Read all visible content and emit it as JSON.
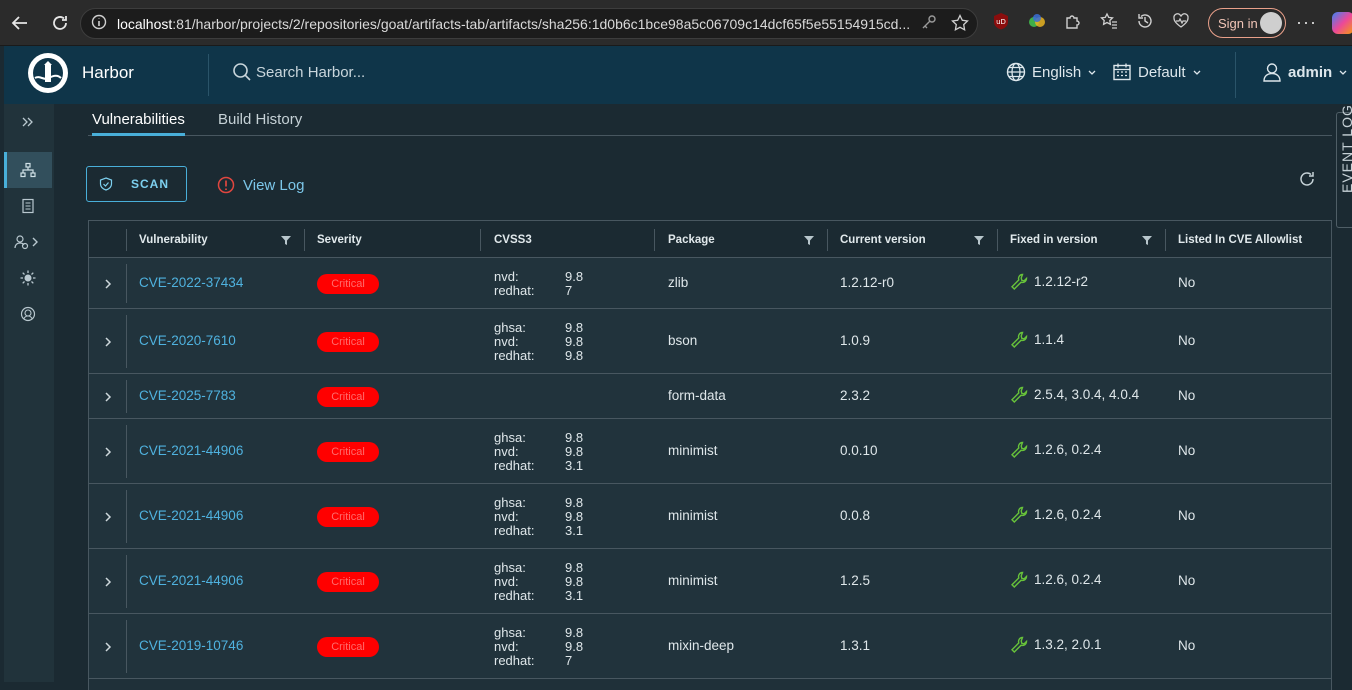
{
  "browser": {
    "url_host": "localhost",
    "url_rest": ":81/harbor/projects/2/repositories/goat/artifacts-tab/artifacts/sha256:1d0b6c1bce98a5c06709c14dcf65f5e55154915cd...",
    "signin_label": "Sign in"
  },
  "header": {
    "brand": "Harbor",
    "search_placeholder": "Search Harbor...",
    "language": "English",
    "theme": "Default",
    "user": "admin"
  },
  "tabs": [
    {
      "label": "Vulnerabilities",
      "active": true
    },
    {
      "label": "Build History",
      "active": false
    }
  ],
  "toolbar": {
    "scan_label": "SCAN",
    "view_log_label": "View Log",
    "event_log_label": "EVENT LOG"
  },
  "columns": [
    "Vulnerability",
    "Severity",
    "CVSS3",
    "Package",
    "Current version",
    "Fixed in version",
    "Listed In CVE Allowlist"
  ],
  "rows": [
    {
      "id": "CVE-2022-37434",
      "severity": "Critical",
      "cvss": [
        [
          "nvd:",
          "9.8"
        ],
        [
          "redhat:",
          "7"
        ]
      ],
      "package": "zlib",
      "current": "1.2.12-r0",
      "fixed": "1.2.12-r2",
      "allowlist": "No"
    },
    {
      "id": "CVE-2020-7610",
      "severity": "Critical",
      "cvss": [
        [
          "ghsa:",
          "9.8"
        ],
        [
          "nvd:",
          "9.8"
        ],
        [
          "redhat:",
          "9.8"
        ]
      ],
      "package": "bson",
      "current": "1.0.9",
      "fixed": "1.1.4",
      "allowlist": "No"
    },
    {
      "id": "CVE-2025-7783",
      "severity": "Critical",
      "cvss": [],
      "package": "form-data",
      "current": "2.3.2",
      "fixed": "2.5.4, 3.0.4, 4.0.4",
      "allowlist": "No"
    },
    {
      "id": "CVE-2021-44906",
      "severity": "Critical",
      "cvss": [
        [
          "ghsa:",
          "9.8"
        ],
        [
          "nvd:",
          "9.8"
        ],
        [
          "redhat:",
          "3.1"
        ]
      ],
      "package": "minimist",
      "current": "0.0.10",
      "fixed": "1.2.6, 0.2.4",
      "allowlist": "No"
    },
    {
      "id": "CVE-2021-44906",
      "severity": "Critical",
      "cvss": [
        [
          "ghsa:",
          "9.8"
        ],
        [
          "nvd:",
          "9.8"
        ],
        [
          "redhat:",
          "3.1"
        ]
      ],
      "package": "minimist",
      "current": "0.0.8",
      "fixed": "1.2.6, 0.2.4",
      "allowlist": "No"
    },
    {
      "id": "CVE-2021-44906",
      "severity": "Critical",
      "cvss": [
        [
          "ghsa:",
          "9.8"
        ],
        [
          "nvd:",
          "9.8"
        ],
        [
          "redhat:",
          "3.1"
        ]
      ],
      "package": "minimist",
      "current": "1.2.5",
      "fixed": "1.2.6, 0.2.4",
      "allowlist": "No"
    },
    {
      "id": "CVE-2019-10746",
      "severity": "Critical",
      "cvss": [
        [
          "ghsa:",
          "9.8"
        ],
        [
          "nvd:",
          "9.8"
        ],
        [
          "redhat:",
          "7"
        ]
      ],
      "package": "mixin-deep",
      "current": "1.3.1",
      "fixed": "1.3.2, 2.0.1",
      "allowlist": "No"
    }
  ],
  "colors": {
    "accent": "#49afd9",
    "critical": "#ff0000",
    "header_bg": "#0f3549"
  }
}
